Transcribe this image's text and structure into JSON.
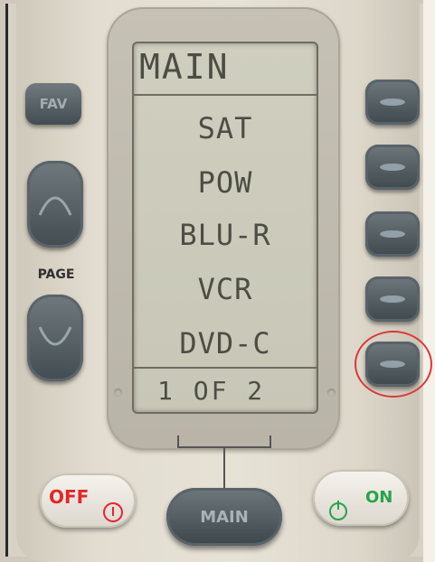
{
  "screen": {
    "title": "MAIN",
    "items": [
      "SAT",
      "POW",
      "BLU-R",
      "VCR",
      "DVD-C"
    ],
    "page_indicator": "1 OF 2"
  },
  "buttons": {
    "fav_label": "FAV",
    "page_label": "PAGE",
    "off_label": "OFF",
    "main_label": "MAIN",
    "on_label": "ON"
  },
  "icons": [
    "chevron-up-icon",
    "chevron-down-icon",
    "power-icon",
    "dash-icon"
  ],
  "colors": {
    "off_red": "#e3262a",
    "on_green": "#27a44a",
    "highlight_ring": "#d83a3a",
    "lcd_bg": "#cfcebf",
    "button_gray": "#556065"
  }
}
